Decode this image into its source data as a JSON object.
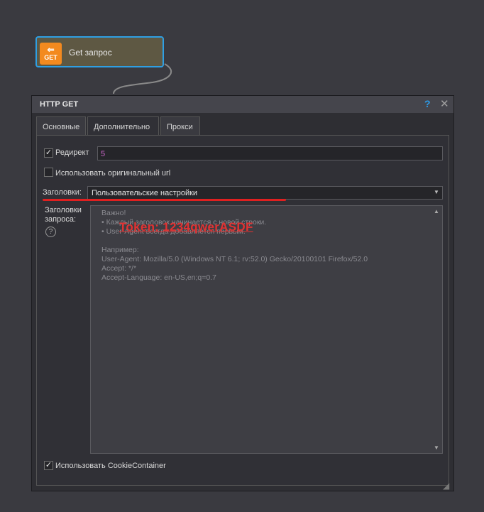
{
  "node": {
    "icon_text": "GET",
    "title": "Get запрос"
  },
  "dialog": {
    "title": "HTTP GET",
    "help": "?",
    "close": "✕"
  },
  "tabs": [
    {
      "label": "Основные",
      "active": false
    },
    {
      "label": "Дополнительно",
      "active": true
    },
    {
      "label": "Прокси",
      "active": false
    }
  ],
  "redirect": {
    "label": "Редирект",
    "checked": true,
    "value": "5"
  },
  "original_url": {
    "label": "Использовать оригинальный url",
    "checked": false
  },
  "headers": {
    "label": "Заголовки:",
    "selected": "Пользовательские настройки"
  },
  "request_headers": {
    "label_line1": "Заголовки",
    "label_line2": "запроса:",
    "placeholder_lines": [
      "Важно!",
      "• Каждый заголовок начинается с новой строки.",
      "• User-Agent всегда добавляется первым.",
      "",
      "Например:",
      "User-Agent: Mozilla/5.0 (Windows NT 6.1; rv:52.0) Gecko/20100101 Firefox/52.0",
      "Accept: */*",
      "Accept-Language: en-US,en;q=0.7"
    ],
    "token_overlay": "Token: 1234qwerASDF"
  },
  "cookie_container": {
    "label": "Использовать CookieContainer",
    "checked": true
  },
  "colors": {
    "accent": "#2f9fe3",
    "node_icon": "#f38a1f",
    "highlight_red": "#e02020"
  }
}
